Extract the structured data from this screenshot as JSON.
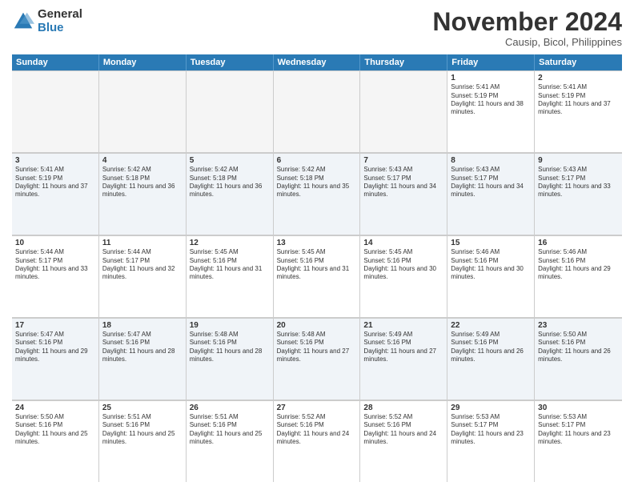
{
  "logo": {
    "general": "General",
    "blue": "Blue"
  },
  "header": {
    "month": "November 2024",
    "location": "Causip, Bicol, Philippines"
  },
  "days": [
    "Sunday",
    "Monday",
    "Tuesday",
    "Wednesday",
    "Thursday",
    "Friday",
    "Saturday"
  ],
  "weeks": [
    [
      {
        "day": "",
        "empty": true
      },
      {
        "day": "",
        "empty": true
      },
      {
        "day": "",
        "empty": true
      },
      {
        "day": "",
        "empty": true
      },
      {
        "day": "",
        "empty": true
      },
      {
        "day": "1",
        "sunrise": "Sunrise: 5:41 AM",
        "sunset": "Sunset: 5:19 PM",
        "daylight": "Daylight: 11 hours and 38 minutes."
      },
      {
        "day": "2",
        "sunrise": "Sunrise: 5:41 AM",
        "sunset": "Sunset: 5:19 PM",
        "daylight": "Daylight: 11 hours and 37 minutes."
      }
    ],
    [
      {
        "day": "3",
        "sunrise": "Sunrise: 5:41 AM",
        "sunset": "Sunset: 5:19 PM",
        "daylight": "Daylight: 11 hours and 37 minutes."
      },
      {
        "day": "4",
        "sunrise": "Sunrise: 5:42 AM",
        "sunset": "Sunset: 5:18 PM",
        "daylight": "Daylight: 11 hours and 36 minutes."
      },
      {
        "day": "5",
        "sunrise": "Sunrise: 5:42 AM",
        "sunset": "Sunset: 5:18 PM",
        "daylight": "Daylight: 11 hours and 36 minutes."
      },
      {
        "day": "6",
        "sunrise": "Sunrise: 5:42 AM",
        "sunset": "Sunset: 5:18 PM",
        "daylight": "Daylight: 11 hours and 35 minutes."
      },
      {
        "day": "7",
        "sunrise": "Sunrise: 5:43 AM",
        "sunset": "Sunset: 5:17 PM",
        "daylight": "Daylight: 11 hours and 34 minutes."
      },
      {
        "day": "8",
        "sunrise": "Sunrise: 5:43 AM",
        "sunset": "Sunset: 5:17 PM",
        "daylight": "Daylight: 11 hours and 34 minutes."
      },
      {
        "day": "9",
        "sunrise": "Sunrise: 5:43 AM",
        "sunset": "Sunset: 5:17 PM",
        "daylight": "Daylight: 11 hours and 33 minutes."
      }
    ],
    [
      {
        "day": "10",
        "sunrise": "Sunrise: 5:44 AM",
        "sunset": "Sunset: 5:17 PM",
        "daylight": "Daylight: 11 hours and 33 minutes."
      },
      {
        "day": "11",
        "sunrise": "Sunrise: 5:44 AM",
        "sunset": "Sunset: 5:17 PM",
        "daylight": "Daylight: 11 hours and 32 minutes."
      },
      {
        "day": "12",
        "sunrise": "Sunrise: 5:45 AM",
        "sunset": "Sunset: 5:16 PM",
        "daylight": "Daylight: 11 hours and 31 minutes."
      },
      {
        "day": "13",
        "sunrise": "Sunrise: 5:45 AM",
        "sunset": "Sunset: 5:16 PM",
        "daylight": "Daylight: 11 hours and 31 minutes."
      },
      {
        "day": "14",
        "sunrise": "Sunrise: 5:45 AM",
        "sunset": "Sunset: 5:16 PM",
        "daylight": "Daylight: 11 hours and 30 minutes."
      },
      {
        "day": "15",
        "sunrise": "Sunrise: 5:46 AM",
        "sunset": "Sunset: 5:16 PM",
        "daylight": "Daylight: 11 hours and 30 minutes."
      },
      {
        "day": "16",
        "sunrise": "Sunrise: 5:46 AM",
        "sunset": "Sunset: 5:16 PM",
        "daylight": "Daylight: 11 hours and 29 minutes."
      }
    ],
    [
      {
        "day": "17",
        "sunrise": "Sunrise: 5:47 AM",
        "sunset": "Sunset: 5:16 PM",
        "daylight": "Daylight: 11 hours and 29 minutes."
      },
      {
        "day": "18",
        "sunrise": "Sunrise: 5:47 AM",
        "sunset": "Sunset: 5:16 PM",
        "daylight": "Daylight: 11 hours and 28 minutes."
      },
      {
        "day": "19",
        "sunrise": "Sunrise: 5:48 AM",
        "sunset": "Sunset: 5:16 PM",
        "daylight": "Daylight: 11 hours and 28 minutes."
      },
      {
        "day": "20",
        "sunrise": "Sunrise: 5:48 AM",
        "sunset": "Sunset: 5:16 PM",
        "daylight": "Daylight: 11 hours and 27 minutes."
      },
      {
        "day": "21",
        "sunrise": "Sunrise: 5:49 AM",
        "sunset": "Sunset: 5:16 PM",
        "daylight": "Daylight: 11 hours and 27 minutes."
      },
      {
        "day": "22",
        "sunrise": "Sunrise: 5:49 AM",
        "sunset": "Sunset: 5:16 PM",
        "daylight": "Daylight: 11 hours and 26 minutes."
      },
      {
        "day": "23",
        "sunrise": "Sunrise: 5:50 AM",
        "sunset": "Sunset: 5:16 PM",
        "daylight": "Daylight: 11 hours and 26 minutes."
      }
    ],
    [
      {
        "day": "24",
        "sunrise": "Sunrise: 5:50 AM",
        "sunset": "Sunset: 5:16 PM",
        "daylight": "Daylight: 11 hours and 25 minutes."
      },
      {
        "day": "25",
        "sunrise": "Sunrise: 5:51 AM",
        "sunset": "Sunset: 5:16 PM",
        "daylight": "Daylight: 11 hours and 25 minutes."
      },
      {
        "day": "26",
        "sunrise": "Sunrise: 5:51 AM",
        "sunset": "Sunset: 5:16 PM",
        "daylight": "Daylight: 11 hours and 25 minutes."
      },
      {
        "day": "27",
        "sunrise": "Sunrise: 5:52 AM",
        "sunset": "Sunset: 5:16 PM",
        "daylight": "Daylight: 11 hours and 24 minutes."
      },
      {
        "day": "28",
        "sunrise": "Sunrise: 5:52 AM",
        "sunset": "Sunset: 5:16 PM",
        "daylight": "Daylight: 11 hours and 24 minutes."
      },
      {
        "day": "29",
        "sunrise": "Sunrise: 5:53 AM",
        "sunset": "Sunset: 5:17 PM",
        "daylight": "Daylight: 11 hours and 23 minutes."
      },
      {
        "day": "30",
        "sunrise": "Sunrise: 5:53 AM",
        "sunset": "Sunset: 5:17 PM",
        "daylight": "Daylight: 11 hours and 23 minutes."
      }
    ]
  ]
}
